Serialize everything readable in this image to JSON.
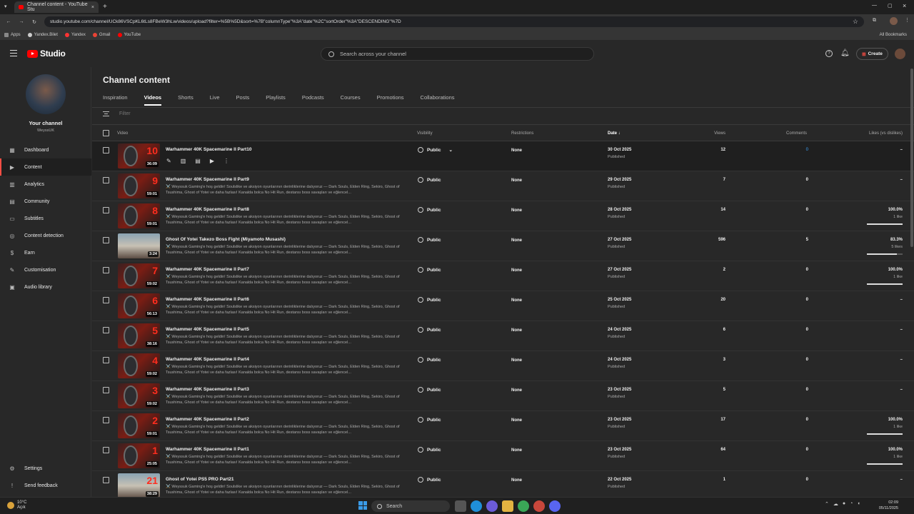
{
  "browser": {
    "tab_title": "Channel content - YouTube Stu",
    "tab_close": "×",
    "new_tab": "+",
    "url": "studio.youtube.com/channel/UCk86VSCpKL6tLs8FBeW3hLw/videos/upload?filter=%5B%5D&sort=%7B\"columnType\"%3A\"date\"%2C\"sortOrder\"%3A\"DESCENDING\"%7D",
    "bookmarks": [
      {
        "label": "Apps",
        "color": "#888888"
      },
      {
        "label": "Yandex.Bilet",
        "color": "#cccccc"
      },
      {
        "label": "Yandex",
        "color": "#ff3333"
      },
      {
        "label": "Gmail",
        "color": "#ea4335"
      },
      {
        "label": "YouTube",
        "color": "#ff0000"
      }
    ],
    "all_bookmarks": "All Bookmarks"
  },
  "header": {
    "logo_text": "Studio",
    "search_placeholder": "Search across your channel",
    "create_label": "Create"
  },
  "sidebar": {
    "channel_name": "Your channel",
    "channel_handle": "WeyssUK",
    "items": [
      {
        "label": "Dashboard",
        "icon": "▦"
      },
      {
        "label": "Content",
        "icon": "▶"
      },
      {
        "label": "Analytics",
        "icon": "▥"
      },
      {
        "label": "Community",
        "icon": "▤"
      },
      {
        "label": "Subtitles",
        "icon": "▭"
      },
      {
        "label": "Content detection",
        "icon": "◎"
      },
      {
        "label": "Earn",
        "icon": "$"
      },
      {
        "label": "Customisation",
        "icon": "✎"
      },
      {
        "label": "Audio library",
        "icon": "▣"
      }
    ],
    "bottom_items": [
      {
        "label": "Settings",
        "icon": "⚙"
      },
      {
        "label": "Send feedback",
        "icon": "!"
      }
    ]
  },
  "main": {
    "title": "Channel content",
    "tabs": [
      "Inspiration",
      "Videos",
      "Shorts",
      "Live",
      "Posts",
      "Playlists",
      "Podcasts",
      "Courses",
      "Promotions",
      "Collaborations"
    ],
    "active_tab": "Videos",
    "filter_placeholder": "Filter",
    "columns": {
      "video": "Video",
      "visibility": "Visibility",
      "restrictions": "Restrictions",
      "date": "Date ↓",
      "views": "Views",
      "comments": "Comments",
      "likes": "Likes (vs dislikes)"
    }
  },
  "accent": {
    "red": "#ff0000",
    "link": "#3ea6ff"
  },
  "rows": [
    {
      "title": "Warhammer 40K Spacemarine II Part10",
      "desc": "",
      "duration": "36:09",
      "num": "10",
      "visibility": "Public",
      "restrictions": "None",
      "date": "30 Oct 2025",
      "status": "Published",
      "views": "12",
      "comments": "0",
      "likes": "–",
      "likes_sub": "",
      "like_fraction": null,
      "hover": true
    },
    {
      "title": "Warhammer 40K Spacemarine II Part9",
      "desc": "⚔️ Weyssuk Gaming'e hoş geldin! Soulslike ve aksiyon oyunlarının derinliklerine dalıyoruz — Dark Souls, Elden Ring, Sekiro, Ghost of Tsushima, Ghost of Yotei ve daha fazlası! Kanalda bolca No Hit Run, destansı boss savaşları ve eğlencel...",
      "duration": "59:01",
      "num": "9",
      "visibility": "Public",
      "restrictions": "None",
      "date": "29 Oct 2025",
      "status": "Published",
      "views": "7",
      "comments": "0",
      "likes": "–",
      "likes_sub": "",
      "like_fraction": null
    },
    {
      "title": "Warhammer 40K Spacemarine II Part8",
      "desc": "⚔️ Weyssuk Gaming'e hoş geldin! Soulslike ve aksiyon oyunlarının derinliklerine dalıyoruz — Dark Souls, Elden Ring, Sekiro, Ghost of Tsushima, Ghost of Yotei ve daha fazlası! Kanalda bolca No Hit Run, destansı boss savaşları ve eğlencel...",
      "duration": "59:01",
      "num": "8",
      "visibility": "Public",
      "restrictions": "None",
      "date": "28 Oct 2025",
      "status": "Published",
      "views": "14",
      "comments": "0",
      "likes": "100.0%",
      "likes_sub": "1 like",
      "like_fraction": 1.0
    },
    {
      "title": "Ghost Of Yotei Takezo Boss Fight (Miyamoto Musashi)",
      "desc": "⚔️ Weyssuk Gaming'e hoş geldin! Soulslike ve aksiyon oyunlarının derinliklerine dalıyoruz — Dark Souls, Elden Ring, Sekiro, Ghost of Tsushima, Ghost of Yotei ve daha fazlası! Kanalda bolca No Hit Run, destansı boss savaşları ve eğlencel...",
      "duration": "3:24",
      "num": "",
      "ghost": true,
      "visibility": "Public",
      "restrictions": "None",
      "date": "27 Oct 2025",
      "status": "Published",
      "views": "596",
      "comments": "5",
      "likes": "83.3%",
      "likes_sub": "5 likes",
      "like_fraction": 0.833
    },
    {
      "title": "Warhammer 40K Spacemarine II Part7",
      "desc": "⚔️ Weyssuk Gaming'e hoş geldin! Soulslike ve aksiyon oyunlarının derinliklerine dalıyoruz — Dark Souls, Elden Ring, Sekiro, Ghost of Tsushima, Ghost of Yotei ve daha fazlası! Kanalda bolca No Hit Run, destansı boss savaşları ve eğlencel...",
      "duration": "59:02",
      "num": "7",
      "visibility": "Public",
      "restrictions": "None",
      "date": "27 Oct 2025",
      "status": "Published",
      "views": "2",
      "comments": "0",
      "likes": "100.0%",
      "likes_sub": "1 like",
      "like_fraction": 1.0
    },
    {
      "title": "Warhammer 40K Spacemarine II Part6",
      "desc": "⚔️ Weyssuk Gaming'e hoş geldin! Soulslike ve aksiyon oyunlarının derinliklerine dalıyoruz — Dark Souls, Elden Ring, Sekiro, Ghost of Tsushima, Ghost of Yotei ve daha fazlası! Kanalda bolca No Hit Run, destansı boss savaşları ve eğlencel...",
      "duration": "56:13",
      "num": "6",
      "visibility": "Public",
      "restrictions": "None",
      "date": "25 Oct 2025",
      "status": "Published",
      "views": "20",
      "comments": "0",
      "likes": "–",
      "likes_sub": "",
      "like_fraction": null
    },
    {
      "title": "Warhammer 40K Spacemarine II Part5",
      "desc": "⚔️ Weyssuk Gaming'e hoş geldin! Soulslike ve aksiyon oyunlarının derinliklerine dalıyoruz — Dark Souls, Elden Ring, Sekiro, Ghost of Tsushima, Ghost of Yotei ve daha fazlası! Kanalda bolca No Hit Run, destansı boss savaşları ve eğlencel...",
      "duration": "38:16",
      "num": "5",
      "visibility": "Public",
      "restrictions": "None",
      "date": "24 Oct 2025",
      "status": "Published",
      "views": "6",
      "comments": "0",
      "likes": "–",
      "likes_sub": "",
      "like_fraction": null
    },
    {
      "title": "Warhammer 40K Spacemarine II Part4",
      "desc": "⚔️ Weyssuk Gaming'e hoş geldin! Soulslike ve aksiyon oyunlarının derinliklerine dalıyoruz — Dark Souls, Elden Ring, Sekiro, Ghost of Tsushima, Ghost of Yotei ve daha fazlası! Kanalda bolca No Hit Run, destansı boss savaşları ve eğlencel...",
      "duration": "59:02",
      "num": "4",
      "visibility": "Public",
      "restrictions": "None",
      "date": "24 Oct 2025",
      "status": "Published",
      "views": "3",
      "comments": "0",
      "likes": "–",
      "likes_sub": "",
      "like_fraction": null
    },
    {
      "title": "Warhammer 40K Spacemarine II Part3",
      "desc": "⚔️ Weyssuk Gaming'e hoş geldin! Soulslike ve aksiyon oyunlarının derinliklerine dalıyoruz — Dark Souls, Elden Ring, Sekiro, Ghost of Tsushima, Ghost of Yotei ve daha fazlası! Kanalda bolca No Hit Run, destansı boss savaşları ve eğlencel...",
      "duration": "59:02",
      "num": "3",
      "visibility": "Public",
      "restrictions": "None",
      "date": "23 Oct 2025",
      "status": "Published",
      "views": "5",
      "comments": "0",
      "likes": "–",
      "likes_sub": "",
      "like_fraction": null
    },
    {
      "title": "Warhammer 40K Spacemarine II Part2",
      "desc": "⚔️ Weyssuk Gaming'e hoş geldin! Soulslike ve aksiyon oyunlarının derinliklerine dalıyoruz — Dark Souls, Elden Ring, Sekiro, Ghost of Tsushima, Ghost of Yotei ve daha fazlası! Kanalda bolca No Hit Run, destansı boss savaşları ve eğlencel...",
      "duration": "59:01",
      "num": "2",
      "visibility": "Public",
      "restrictions": "None",
      "date": "23 Oct 2025",
      "status": "Published",
      "views": "17",
      "comments": "0",
      "likes": "100.0%",
      "likes_sub": "1 like",
      "like_fraction": 1.0
    },
    {
      "title": "Warhammer 40K Spacemarine II Part1",
      "desc": "⚔️ Weyssuk Gaming'e hoş geldin! Soulslike ve aksiyon oyunlarının derinliklerine dalıyoruz — Dark Souls, Elden Ring, Sekiro, Ghost of Tsushima, Ghost of Yotei ve daha fazlası! Kanalda bolca No Hit Run, destansı boss savaşları ve eğlencel...",
      "duration": "25:05",
      "num": "1",
      "visibility": "Public",
      "restrictions": "None",
      "date": "23 Oct 2025",
      "status": "Published",
      "views": "64",
      "comments": "0",
      "likes": "100.0%",
      "likes_sub": "1 like",
      "like_fraction": 1.0
    },
    {
      "title": "Ghost of Yotei PS5 PRO Part21",
      "desc": "⚔️ Weyssuk Gaming'e hoş geldin! Soulslike ve aksiyon oyunlarının derinliklerine dalıyoruz — Dark Souls, Elden Ring, Sekiro, Ghost of Tsushima, Ghost of Yotei ve daha fazlası! Kanalda bolca No Hit Run, destansı boss savaşları ve eğlencel...",
      "duration": "38:29",
      "num": "21",
      "ghost": true,
      "visibility": "Public",
      "restrictions": "None",
      "date": "22 Oct 2025",
      "status": "Published",
      "views": "1",
      "comments": "0",
      "likes": "–",
      "likes_sub": "",
      "like_fraction": null
    }
  ],
  "taskbar": {
    "temp": "10°C",
    "weather": "Açık",
    "search_label": "Search",
    "time": "02:09",
    "date": "05/11/2025"
  }
}
